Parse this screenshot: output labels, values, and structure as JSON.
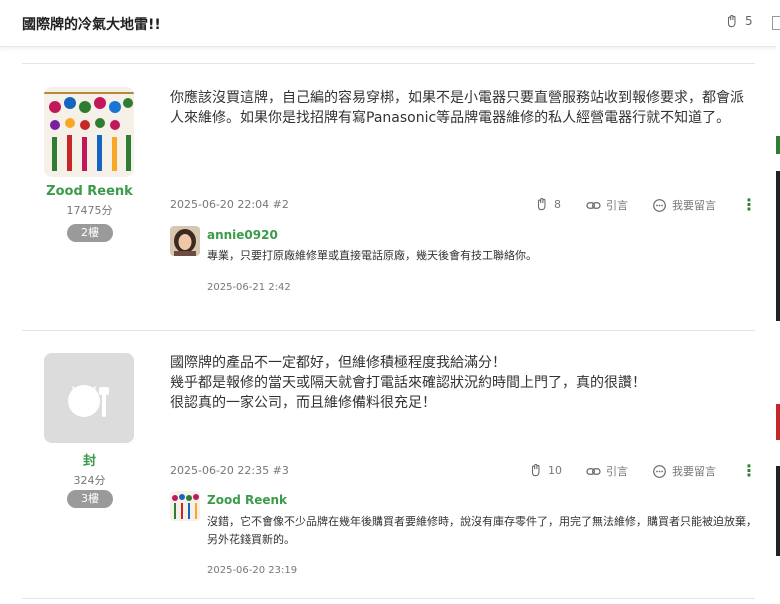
{
  "header": {
    "title": "國際牌的冷氣大地雷!!",
    "like_count": "5"
  },
  "posts": [
    {
      "author": {
        "name": "Zood Reenk",
        "score": "17475分"
      },
      "floor": "2樓",
      "content": "你應該沒買這牌，自己編的容易穿梆，如果不是小電器只要直營服務站收到報修要求，都會派人來維修。如果你是找招牌有寫Panasonic等品牌電器維修的私人經營電器行就不知道了。",
      "meta": "2025-06-20 22:04 #2",
      "like_count": "8",
      "quote_label": "引言",
      "reply_label": "我要留言",
      "reply": {
        "name": "annie0920",
        "text": "專業，只要打原廠維修單或直接電話原廠，幾天後會有技工聯絡你。",
        "time": "2025-06-21 2:42"
      }
    },
    {
      "author": {
        "name": "封",
        "score": "324分"
      },
      "floor": "3樓",
      "content_lines": [
        "國際牌的產品不一定都好，但維修積極程度我給滿分！",
        "幾乎都是報修的當天或隔天就會打電話來確認狀況約時間上門了，真的很讚！",
        "很認真的一家公司，而且維修備料很充足！"
      ],
      "meta": "2025-06-20 22:35 #3",
      "like_count": "10",
      "quote_label": "引言",
      "reply_label": "我要留言",
      "reply": {
        "name": "Zood Reenk",
        "text": "沒錯，它不會像不少品牌在幾年後購買者要維修時，說沒有庫存零件了，用完了無法維修，購買者只能被迫放棄，另外花錢買新的。",
        "time": "2025-06-20 23:19"
      }
    }
  ],
  "colors": {
    "accent_green": "#3b9b4a",
    "badge_gray": "#9a9a9a",
    "rail_green": "#2e7d32",
    "rail_red": "#c62828"
  }
}
